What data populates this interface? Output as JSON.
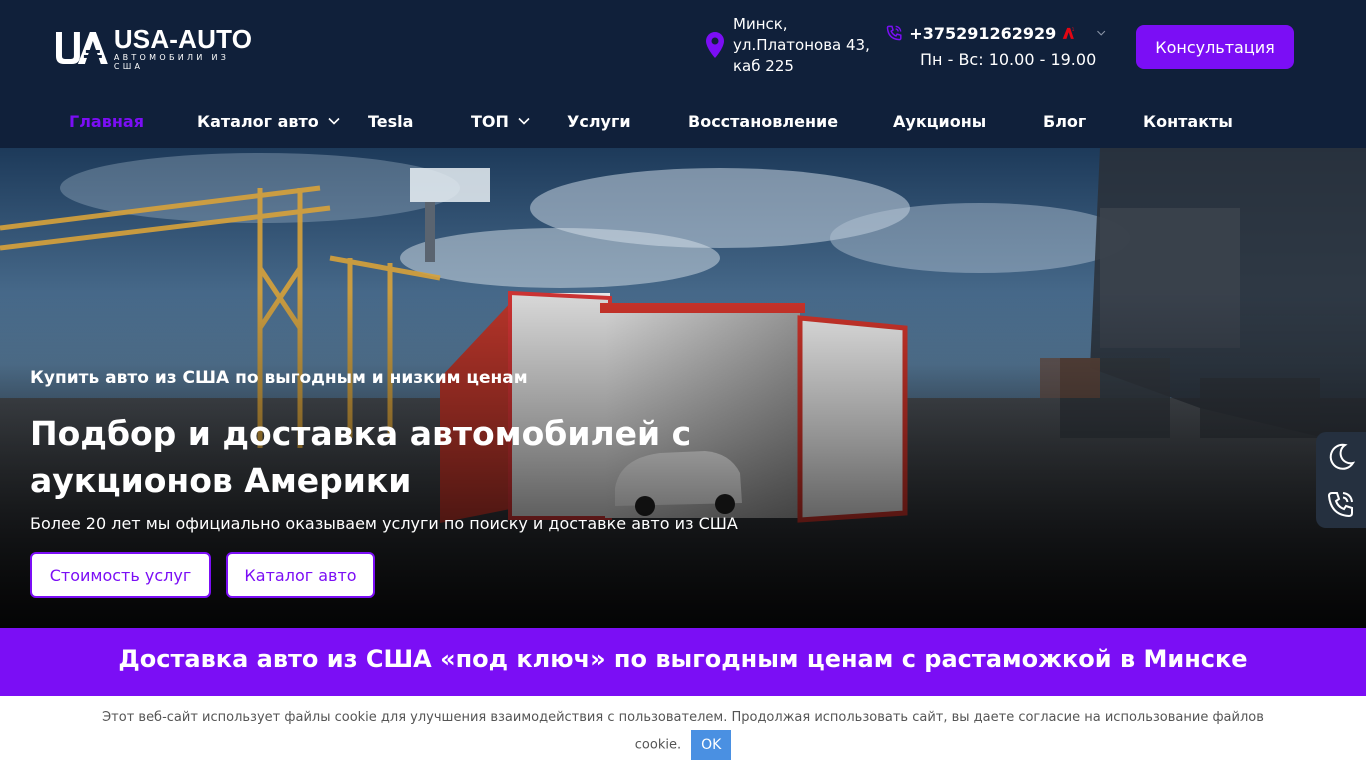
{
  "header": {
    "logo": {
      "title": "USA-AUTO",
      "subtitle": "АВТОМОБИЛИ ИЗ США"
    },
    "address": {
      "line1": "Минск,",
      "line2": "ул.Платонова 43,",
      "line3": "каб 225"
    },
    "phone": {
      "number": "+375291262929",
      "hours": "Пн - Вс: 10.00 - 19.00"
    },
    "consult_label": "Консультация"
  },
  "nav": {
    "items": [
      {
        "label": "Главная"
      },
      {
        "label": "Каталог авто"
      },
      {
        "label": "Tesla"
      },
      {
        "label": "ТОП"
      },
      {
        "label": "Услуги"
      },
      {
        "label": "Восстановление"
      },
      {
        "label": "Аукционы"
      },
      {
        "label": "Блог"
      },
      {
        "label": "Контакты"
      }
    ]
  },
  "hero": {
    "subtitle": "Купить авто из США по выгодным и низким ценам",
    "title": "Подбор и доставка автомобилей с аукционов Америки",
    "description": "Более 20 лет мы официально оказываем услуги по поиску и доставке авто из США",
    "btn_prices": "Стоимость услуг",
    "btn_catalog": "Каталог авто"
  },
  "banner": {
    "text": "Доставка авто из США «под ключ» по выгодным ценам с растаможкой в Минске"
  },
  "cookie": {
    "text": "Этот веб-сайт использует файлы cookie для улучшения взаимодействия с пользователем. Продолжая использовать сайт, вы даете согласие на использование файлов cookie.",
    "ok_label": "OK"
  },
  "colors": {
    "accent": "#7b0ef5",
    "header_bg": "#10203a",
    "cookie_ok": "#4a90e2"
  },
  "icons": [
    "logo-mark",
    "location-pin-icon",
    "phone-icon",
    "operator-a1-icon",
    "chevron-down-icon",
    "moon-icon",
    "phone-call-icon"
  ]
}
